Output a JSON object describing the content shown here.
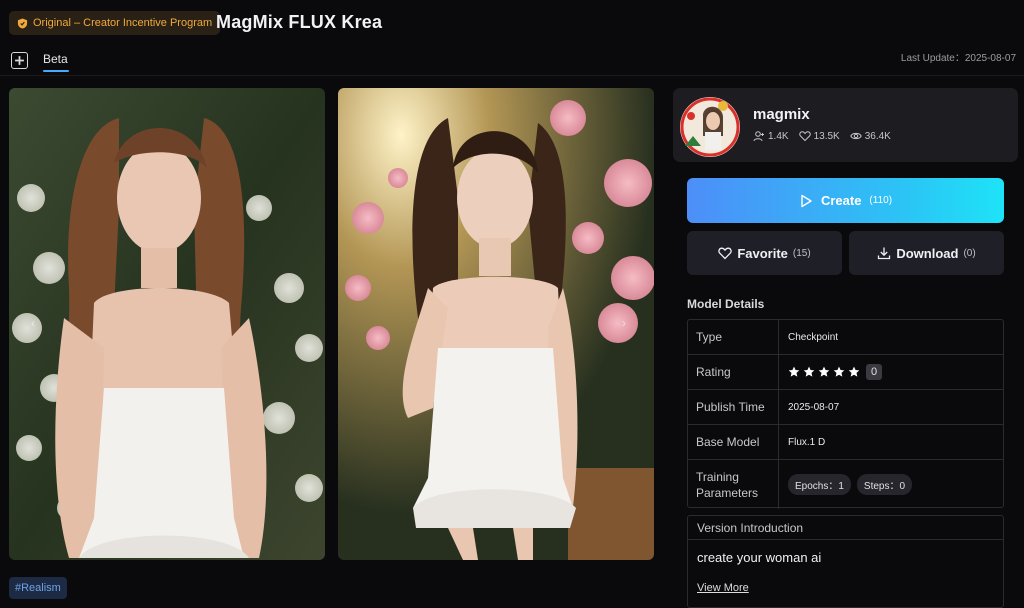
{
  "header": {
    "badge_label": "Original – Creator Incentive Program",
    "badge_icon": "shield-icon",
    "title": "MagMix FLUX Krea",
    "tab_label": "Beta",
    "last_update": "Last Update：2025-08-07"
  },
  "gallery": {
    "prev_arrow": "‹",
    "next_arrow": "›",
    "tag": "#Realism"
  },
  "creator": {
    "name": "magmix",
    "followers": "1.4K",
    "likes": "13.5K",
    "views": "36.4K"
  },
  "actions": {
    "create_label": "Create",
    "create_count": "(110)",
    "favorite_label": "Favorite",
    "favorite_count": "(15)",
    "download_label": "Download",
    "download_count": "(0)"
  },
  "details": {
    "title": "Model Details",
    "type_label": "Type",
    "type_value": "Checkpoint",
    "rating_label": "Rating",
    "rating_stars": 5,
    "rating_count": "0",
    "publish_label": "Publish Time",
    "publish_value": "2025-08-07",
    "base_label": "Base Model",
    "base_value": "Flux.1 D",
    "training_label_1": "Training",
    "training_label_2": "Parameters",
    "epochs": "Epochs：1",
    "steps": "Steps：0"
  },
  "intro": {
    "title": "Version Introduction",
    "text": "create your woman ai",
    "view_more": "View More"
  },
  "colors": {
    "background": "#0a0a0d",
    "accent_start": "#4d8ef8",
    "accent_end": "#1ee3f7",
    "badge_text": "#f0a93a",
    "tag_text": "#6ea2e6"
  }
}
